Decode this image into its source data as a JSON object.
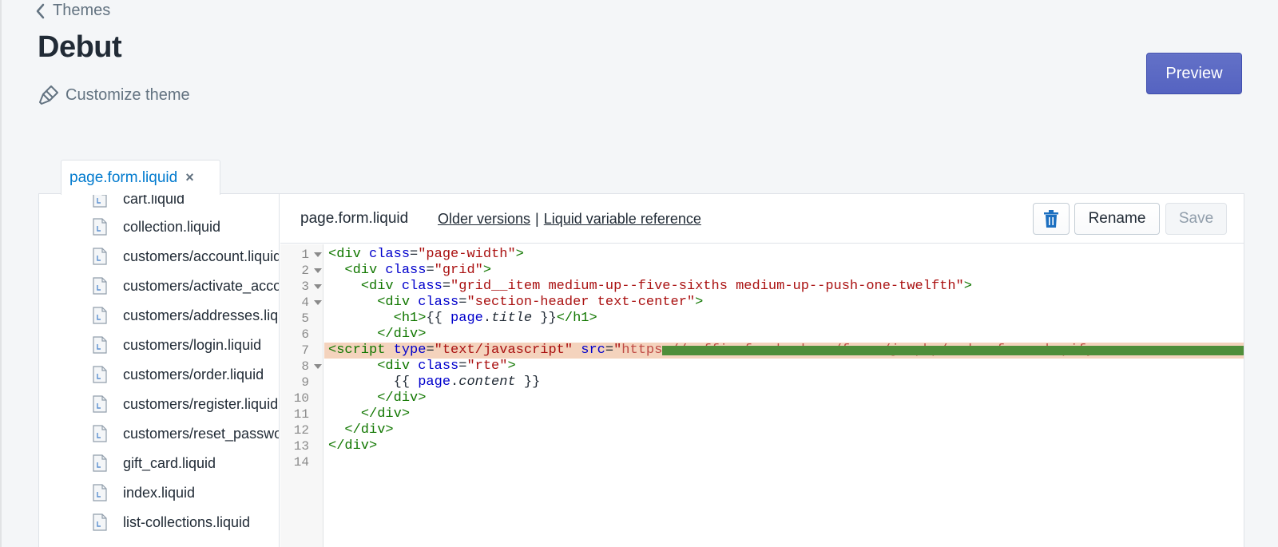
{
  "header": {
    "back_label": "Themes",
    "title": "Debut",
    "customize_label": "Customize theme",
    "preview_label": "Preview"
  },
  "tab": {
    "label": "page.form.liquid",
    "close": "×"
  },
  "sidebar": {
    "files": [
      "cart.liquid",
      "collection.liquid",
      "customers/account.liquid",
      "customers/activate_account.liquid",
      "customers/addresses.liquid",
      "customers/login.liquid",
      "customers/order.liquid",
      "customers/register.liquid",
      "customers/reset_password.liquid",
      "gift_card.liquid",
      "index.liquid",
      "list-collections.liquid"
    ]
  },
  "editor": {
    "filename": "page.form.liquid",
    "older_versions": "Older versions",
    "separator": "|",
    "variable_reference": "Liquid variable reference",
    "rename_label": "Rename",
    "save_label": "Save",
    "line_numbers": [
      "1",
      "2",
      "3",
      "4",
      "5",
      "6",
      "7",
      "8",
      "9",
      "10",
      "11",
      "12",
      "13",
      "14"
    ],
    "code": {
      "l1_tag_open": "<div",
      "l1_attr": "class",
      "l1_val": "\"page-width\"",
      "l2_val": "\"grid\"",
      "l3_val": "\"grid__item medium-up--five-sixths medium-up--push-one-twelfth\"",
      "l4_val": "\"section-header text-center\"",
      "l5_open": "<h1>",
      "l5_lq_open": "{{ ",
      "l5_obj": "page",
      "l5_prop": "title",
      "l5_lq_close": " }}",
      "l5_close": "</h1>",
      "l6": "</div>",
      "l7_tag": "<script",
      "l7_attr_type": "type",
      "l7_type_val": "\"text/javascript\"",
      "l7_attr_src": "src",
      "l7_src_start": "\"",
      "l7_src_redacted": "https://coffin.formbackcom/forms/js.php/order_form_shopify",
      "l8_val": "\"rte\"",
      "l9_lq_open": "{{ ",
      "l9_obj": "page",
      "l9_prop": "content",
      "l9_lq_close": " }}",
      "l10": "</div>",
      "l11": "</div>",
      "l12": "</div>",
      "l13": "</div>"
    }
  }
}
